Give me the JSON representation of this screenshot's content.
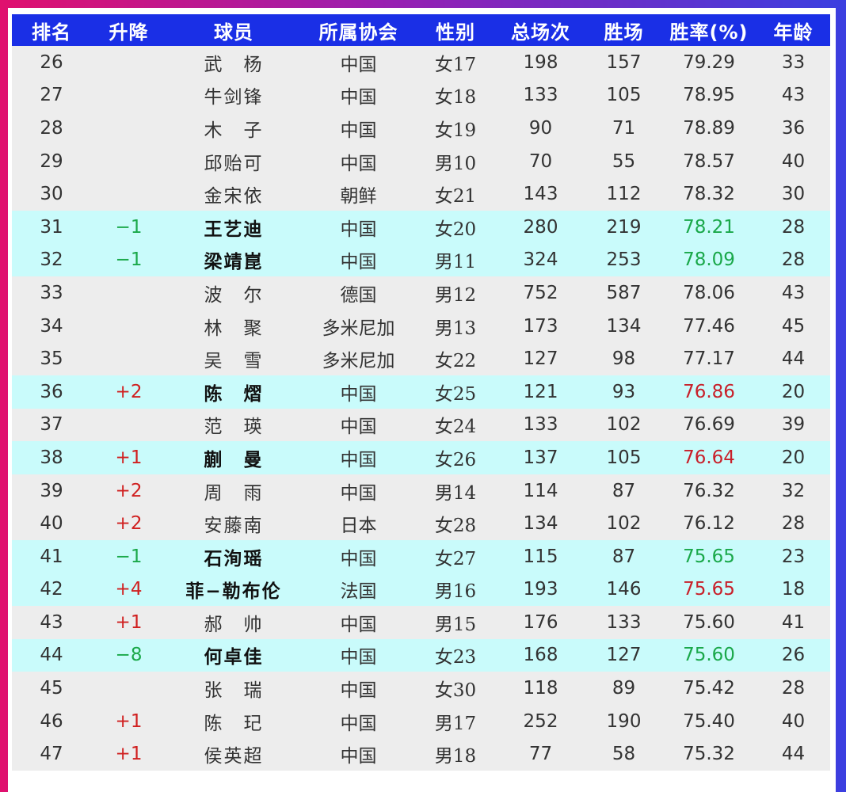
{
  "headers": [
    "排名",
    "升降",
    "球员",
    "所属协会",
    "性别",
    "总场次",
    "胜场",
    "胜率(%)",
    "年龄"
  ],
  "colors": {
    "up": "#d02020",
    "down": "#1aa84a",
    "header_bg": "#1a2fe6",
    "highlight_bg": "#c9fbfb"
  },
  "rows": [
    {
      "rank": "26",
      "change": "",
      "name": "武　杨",
      "assoc": "中国",
      "gender": "女17",
      "total": "198",
      "wins": "157",
      "rate": "79.29",
      "age": "33",
      "hl": false,
      "dir": ""
    },
    {
      "rank": "27",
      "change": "",
      "name": "牛剑锋",
      "assoc": "中国",
      "gender": "女18",
      "total": "133",
      "wins": "105",
      "rate": "78.95",
      "age": "43",
      "hl": false,
      "dir": ""
    },
    {
      "rank": "28",
      "change": "",
      "name": "木　子",
      "assoc": "中国",
      "gender": "女19",
      "total": "90",
      "wins": "71",
      "rate": "78.89",
      "age": "36",
      "hl": false,
      "dir": ""
    },
    {
      "rank": "29",
      "change": "",
      "name": "邱贻可",
      "assoc": "中国",
      "gender": "男10",
      "total": "70",
      "wins": "55",
      "rate": "78.57",
      "age": "40",
      "hl": false,
      "dir": ""
    },
    {
      "rank": "30",
      "change": "",
      "name": "金宋依",
      "assoc": "朝鲜",
      "gender": "女21",
      "total": "143",
      "wins": "112",
      "rate": "78.32",
      "age": "30",
      "hl": false,
      "dir": ""
    },
    {
      "rank": "31",
      "change": "−1",
      "name": "王艺迪",
      "assoc": "中国",
      "gender": "女20",
      "total": "280",
      "wins": "219",
      "rate": "78.21",
      "age": "28",
      "hl": true,
      "dir": "down"
    },
    {
      "rank": "32",
      "change": "−1",
      "name": "梁靖崑",
      "assoc": "中国",
      "gender": "男11",
      "total": "324",
      "wins": "253",
      "rate": "78.09",
      "age": "28",
      "hl": true,
      "dir": "down"
    },
    {
      "rank": "33",
      "change": "",
      "name": "波　尔",
      "assoc": "德国",
      "gender": "男12",
      "total": "752",
      "wins": "587",
      "rate": "78.06",
      "age": "43",
      "hl": false,
      "dir": ""
    },
    {
      "rank": "34",
      "change": "",
      "name": "林　聚",
      "assoc": "多米尼加",
      "gender": "男13",
      "total": "173",
      "wins": "134",
      "rate": "77.46",
      "age": "45",
      "hl": false,
      "dir": ""
    },
    {
      "rank": "35",
      "change": "",
      "name": "吴　雪",
      "assoc": "多米尼加",
      "gender": "女22",
      "total": "127",
      "wins": "98",
      "rate": "77.17",
      "age": "44",
      "hl": false,
      "dir": ""
    },
    {
      "rank": "36",
      "change": "+2",
      "name": "陈　熠",
      "assoc": "中国",
      "gender": "女25",
      "total": "121",
      "wins": "93",
      "rate": "76.86",
      "age": "20",
      "hl": true,
      "dir": "up"
    },
    {
      "rank": "37",
      "change": "",
      "name": "范　瑛",
      "assoc": "中国",
      "gender": "女24",
      "total": "133",
      "wins": "102",
      "rate": "76.69",
      "age": "39",
      "hl": false,
      "dir": ""
    },
    {
      "rank": "38",
      "change": "+1",
      "name": "蒯　曼",
      "assoc": "中国",
      "gender": "女26",
      "total": "137",
      "wins": "105",
      "rate": "76.64",
      "age": "20",
      "hl": true,
      "dir": "up"
    },
    {
      "rank": "39",
      "change": "+2",
      "name": "周　雨",
      "assoc": "中国",
      "gender": "男14",
      "total": "114",
      "wins": "87",
      "rate": "76.32",
      "age": "32",
      "hl": false,
      "dir": "up"
    },
    {
      "rank": "40",
      "change": "+2",
      "name": "安藤南",
      "assoc": "日本",
      "gender": "女28",
      "total": "134",
      "wins": "102",
      "rate": "76.12",
      "age": "28",
      "hl": false,
      "dir": "up"
    },
    {
      "rank": "41",
      "change": "−1",
      "name": "石洵瑶",
      "assoc": "中国",
      "gender": "女27",
      "total": "115",
      "wins": "87",
      "rate": "75.65",
      "age": "23",
      "hl": true,
      "dir": "down"
    },
    {
      "rank": "42",
      "change": "+4",
      "name": "菲−勒布伦",
      "assoc": "法国",
      "gender": "男16",
      "total": "193",
      "wins": "146",
      "rate": "75.65",
      "age": "18",
      "hl": true,
      "dir": "up"
    },
    {
      "rank": "43",
      "change": "+1",
      "name": "郝　帅",
      "assoc": "中国",
      "gender": "男15",
      "total": "176",
      "wins": "133",
      "rate": "75.60",
      "age": "41",
      "hl": false,
      "dir": "up"
    },
    {
      "rank": "44",
      "change": "−8",
      "name": "何卓佳",
      "assoc": "中国",
      "gender": "女23",
      "total": "168",
      "wins": "127",
      "rate": "75.60",
      "age": "26",
      "hl": true,
      "dir": "down"
    },
    {
      "rank": "45",
      "change": "",
      "name": "张　瑞",
      "assoc": "中国",
      "gender": "女30",
      "total": "118",
      "wins": "89",
      "rate": "75.42",
      "age": "28",
      "hl": false,
      "dir": ""
    },
    {
      "rank": "46",
      "change": "+1",
      "name": "陈　玘",
      "assoc": "中国",
      "gender": "男17",
      "total": "252",
      "wins": "190",
      "rate": "75.40",
      "age": "40",
      "hl": false,
      "dir": "up"
    },
    {
      "rank": "47",
      "change": "+1",
      "name": "侯英超",
      "assoc": "中国",
      "gender": "男18",
      "total": "77",
      "wins": "58",
      "rate": "75.32",
      "age": "44",
      "hl": false,
      "dir": "up"
    }
  ]
}
